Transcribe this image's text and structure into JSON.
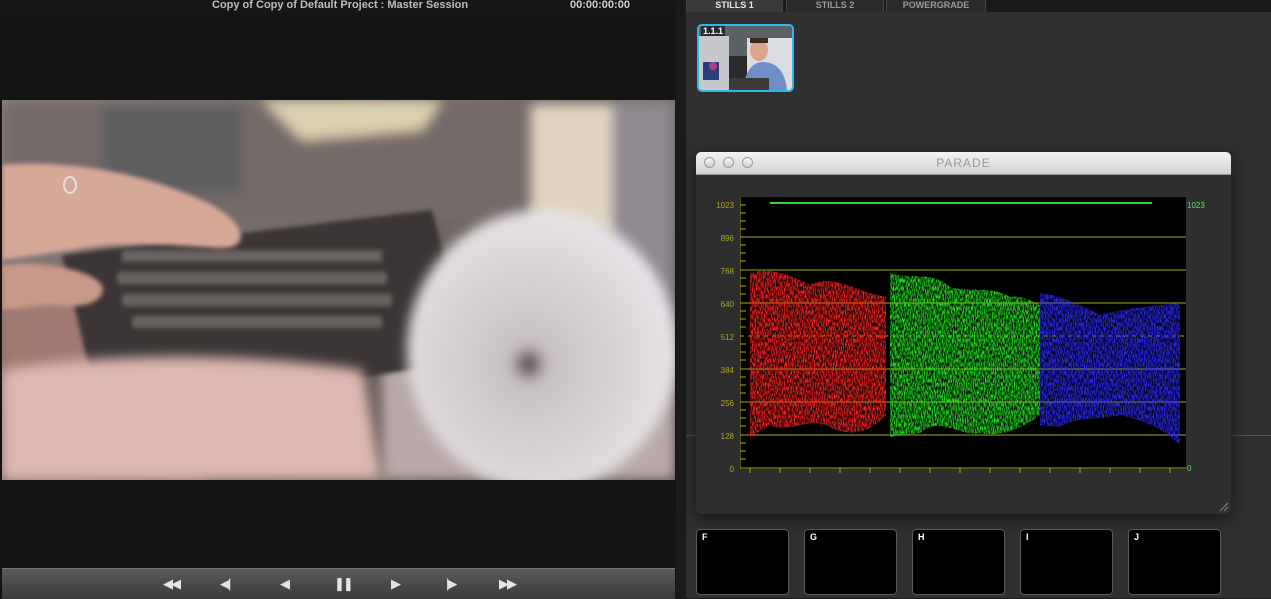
{
  "viewer": {
    "title": "Copy of Copy of Default Project : Master Session",
    "timecode": "00:00:00:00",
    "transport": [
      {
        "name": "rewind-icon",
        "glyph": "◀◀"
      },
      {
        "name": "step-back-icon",
        "glyph": "◀|"
      },
      {
        "name": "play-reverse-icon",
        "glyph": "◀"
      },
      {
        "name": "pause-icon",
        "glyph": "❚❚"
      },
      {
        "name": "play-icon",
        "glyph": "▶"
      },
      {
        "name": "step-forward-icon",
        "glyph": "|▶"
      },
      {
        "name": "fast-forward-icon",
        "glyph": "▶▶"
      }
    ]
  },
  "gallery": {
    "tabs": [
      "STILLS 1",
      "STILLS 2",
      "POWERGRADE"
    ],
    "active_tab": "STILLS 1",
    "still_label": "1.1.1"
  },
  "parade": {
    "title": "PARADE",
    "scale_left": [
      "1023",
      "896",
      "768",
      "640",
      "512",
      "384",
      "256",
      "128",
      "0"
    ],
    "scale_right": [
      "1023",
      "0"
    ],
    "channels": [
      {
        "name": "red",
        "color": "#ff2020"
      },
      {
        "name": "green",
        "color": "#22e622"
      },
      {
        "name": "blue",
        "color": "#2a2aff"
      }
    ]
  },
  "memories": [
    "F",
    "G",
    "H",
    "I",
    "J"
  ],
  "colors": {
    "accent": "#36b6e6",
    "scale_yellow": "#a8a820",
    "scale_green": "#5fe05f"
  }
}
